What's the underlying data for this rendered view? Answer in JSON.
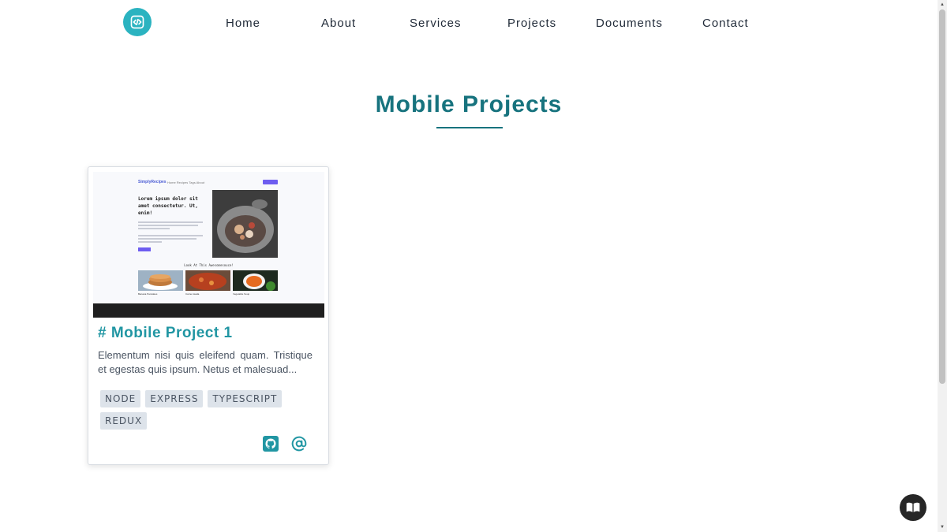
{
  "nav": {
    "logo_icon": "code-icon",
    "links": [
      "Home",
      "About",
      "Services",
      "Projects",
      "Documents",
      "Contact"
    ]
  },
  "page": {
    "title": "Mobile Projects"
  },
  "project_card": {
    "title": "# Mobile Project 1",
    "description": "Elementum nisi quis eleifend quam. Tristique et egestas quis ipsum. Netus et malesuad...",
    "tags": [
      "NODE",
      "EXPRESS",
      "TYPESCRIPT",
      "REDUX"
    ],
    "icons": [
      "github-icon",
      "at-sign-icon"
    ],
    "screenshot": {
      "brand": "SimplyRecipes",
      "nav_items": "Home  Recipes  Tags  About",
      "hero": "Lorem ipsum dolor sit amet consectetur. Ut, enim!",
      "section_title": "Look At This Awesomesouce!",
      "captions": [
        "Banana Pancakes",
        "Carne Asada",
        "Vegetable Soup"
      ]
    }
  },
  "floating_button": {
    "icon": "book-icon"
  },
  "colors": {
    "accent": "#2bb3c0",
    "heading": "#17737e",
    "card_title": "#2196a3",
    "tag_bg": "#dde3ea"
  }
}
